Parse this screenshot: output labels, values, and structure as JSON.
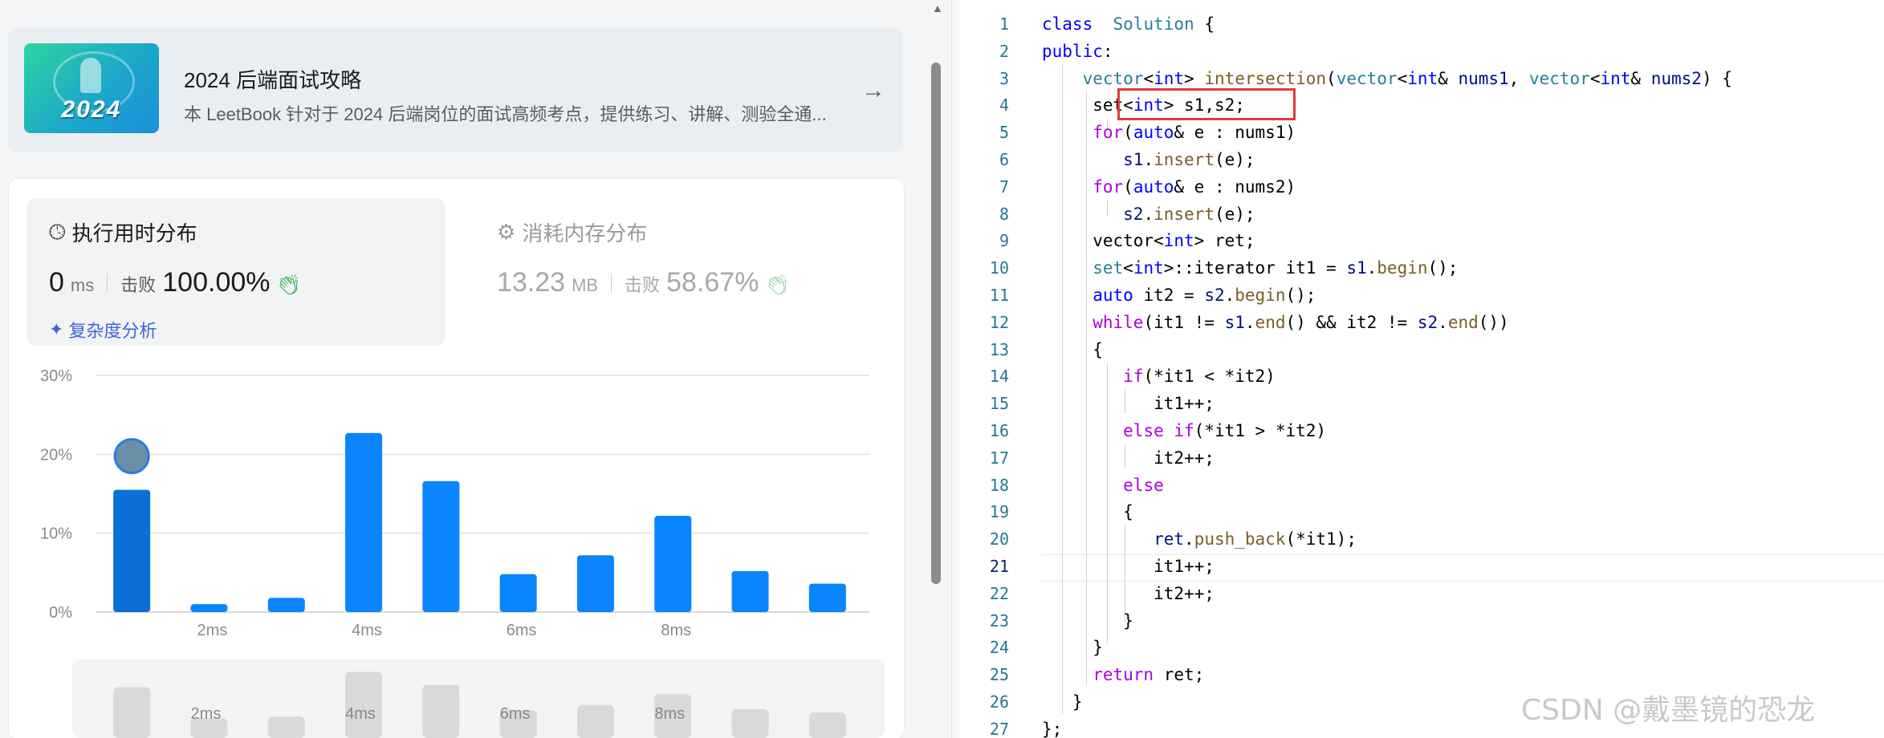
{
  "book": {
    "cover_year": "2024",
    "title": "2024 后端面试攻略",
    "description": "本 LeetBook 针对于 2024 后端岗位的面试高频考点，提供练习、讲解、测验全通..."
  },
  "runtime": {
    "tab_label": "执行用时分布",
    "value": "0",
    "unit": "ms",
    "beat_label": "击败",
    "beat_percent": "100.00%",
    "complexity_link": "复杂度分析"
  },
  "memory": {
    "tab_label": "消耗内存分布",
    "value": "13.23",
    "unit": "MB",
    "beat_label": "击败",
    "beat_percent": "58.67%"
  },
  "chart_data": {
    "type": "bar",
    "y_ticks": [
      "30%",
      "20%",
      "10%",
      "0%"
    ],
    "ylim": [
      0,
      30
    ],
    "grid": true,
    "x_tick_labels": [
      "2ms",
      "4ms",
      "6ms",
      "8ms"
    ],
    "values": [
      15.5,
      1.0,
      1.8,
      22.7,
      16.6,
      4.8,
      7.2,
      12.2,
      5.2,
      3.6
    ],
    "highlight_index": 0,
    "colors": {
      "bar": "#0a84ff",
      "highlight": "#0a6fd6",
      "grid": "#e6e6e6",
      "overview_bar": "#d9d9d9"
    },
    "overview_labels": [
      "2ms",
      "4ms",
      "6ms",
      "8ms"
    ]
  },
  "editor": {
    "active_line": 21,
    "lines": [
      {
        "n": 1,
        "tokens": [
          [
            "kw",
            "class"
          ],
          [
            "",
            "  "
          ],
          [
            "ty",
            "Solution"
          ],
          [
            "",
            " {"
          ]
        ]
      },
      {
        "n": 2,
        "tokens": [
          [
            "kw",
            "public"
          ],
          [
            "",
            ":"
          ]
        ]
      },
      {
        "n": 3,
        "tokens": [
          [
            "",
            "    "
          ],
          [
            "ty",
            "vector"
          ],
          [
            "",
            "<"
          ],
          [
            "kw",
            "int"
          ],
          [
            "",
            "> "
          ],
          [
            "fn",
            "intersection"
          ],
          [
            "",
            "("
          ],
          [
            "ty",
            "vector"
          ],
          [
            "",
            "<"
          ],
          [
            "kw",
            "int"
          ],
          [
            "",
            "& "
          ],
          [
            "vr",
            "nums1"
          ],
          [
            "",
            ", "
          ],
          [
            "ty",
            "vector"
          ],
          [
            "",
            "<"
          ],
          [
            "kw",
            "int"
          ],
          [
            "",
            "& "
          ],
          [
            "vr",
            "nums2"
          ],
          [
            "",
            ") {"
          ]
        ]
      },
      {
        "n": 4,
        "tokens": [
          [
            "",
            "     "
          ],
          [
            "",
            "set"
          ],
          [
            "",
            "<"
          ],
          [
            "kw",
            "int"
          ],
          [
            "",
            "> s1,s2;"
          ]
        ]
      },
      {
        "n": 5,
        "tokens": [
          [
            "",
            "     "
          ],
          [
            "kw2",
            "for"
          ],
          [
            "",
            "("
          ],
          [
            "kw",
            "auto"
          ],
          [
            "",
            "& e : nums1)"
          ]
        ]
      },
      {
        "n": 6,
        "tokens": [
          [
            "",
            "        "
          ],
          [
            "vr",
            "s1"
          ],
          [
            "",
            "."
          ],
          [
            "fn",
            "insert"
          ],
          [
            "",
            "(e);"
          ]
        ]
      },
      {
        "n": 7,
        "tokens": [
          [
            "",
            "     "
          ],
          [
            "kw2",
            "for"
          ],
          [
            "",
            "("
          ],
          [
            "kw",
            "auto"
          ],
          [
            "",
            "& e : nums2)"
          ]
        ]
      },
      {
        "n": 8,
        "tokens": [
          [
            "",
            "        "
          ],
          [
            "vr",
            "s2"
          ],
          [
            "",
            "."
          ],
          [
            "fn",
            "insert"
          ],
          [
            "",
            "(e);"
          ]
        ]
      },
      {
        "n": 9,
        "tokens": [
          [
            "",
            "     "
          ],
          [
            "",
            "vector<"
          ],
          [
            "kw",
            "int"
          ],
          [
            "",
            "> ret;"
          ]
        ]
      },
      {
        "n": 10,
        "tokens": [
          [
            "",
            "     "
          ],
          [
            "ty",
            "set"
          ],
          [
            "",
            "<"
          ],
          [
            "kw",
            "int"
          ],
          [
            "",
            ">::iterator it1 = "
          ],
          [
            "vr",
            "s1"
          ],
          [
            "",
            "."
          ],
          [
            "fn",
            "begin"
          ],
          [
            "",
            "();"
          ]
        ]
      },
      {
        "n": 11,
        "tokens": [
          [
            "",
            "     "
          ],
          [
            "kw",
            "auto"
          ],
          [
            "",
            " it2 = "
          ],
          [
            "vr",
            "s2"
          ],
          [
            "",
            "."
          ],
          [
            "fn",
            "begin"
          ],
          [
            "",
            "();"
          ]
        ]
      },
      {
        "n": 12,
        "tokens": [
          [
            "",
            "     "
          ],
          [
            "kw2",
            "while"
          ],
          [
            "",
            "(it1 != "
          ],
          [
            "vr",
            "s1"
          ],
          [
            "",
            "."
          ],
          [
            "fn",
            "end"
          ],
          [
            "",
            "() && it2 != "
          ],
          [
            "vr",
            "s2"
          ],
          [
            "",
            "."
          ],
          [
            "fn",
            "end"
          ],
          [
            "",
            "())"
          ]
        ]
      },
      {
        "n": 13,
        "tokens": [
          [
            "",
            "     {"
          ]
        ]
      },
      {
        "n": 14,
        "tokens": [
          [
            "",
            "        "
          ],
          [
            "kw2",
            "if"
          ],
          [
            "",
            "(*it1 < *it2)"
          ]
        ]
      },
      {
        "n": 15,
        "tokens": [
          [
            "",
            "           it1++;"
          ]
        ]
      },
      {
        "n": 16,
        "tokens": [
          [
            "",
            "        "
          ],
          [
            "kw2",
            "else if"
          ],
          [
            "",
            "(*it1 > *it2)"
          ]
        ]
      },
      {
        "n": 17,
        "tokens": [
          [
            "",
            "           it2++;"
          ]
        ]
      },
      {
        "n": 18,
        "tokens": [
          [
            "",
            "        "
          ],
          [
            "kw2",
            "else"
          ]
        ]
      },
      {
        "n": 19,
        "tokens": [
          [
            "",
            "        {"
          ]
        ]
      },
      {
        "n": 20,
        "tokens": [
          [
            "",
            "           "
          ],
          [
            "vr",
            "ret"
          ],
          [
            "",
            "."
          ],
          [
            "fn",
            "push_back"
          ],
          [
            "",
            "(*it1);"
          ]
        ]
      },
      {
        "n": 21,
        "tokens": [
          [
            "",
            "           it1++;"
          ]
        ]
      },
      {
        "n": 22,
        "tokens": [
          [
            "",
            "           it2++;"
          ]
        ]
      },
      {
        "n": 23,
        "tokens": [
          [
            "",
            "        }"
          ]
        ]
      },
      {
        "n": 24,
        "tokens": [
          [
            "",
            "     }"
          ]
        ]
      },
      {
        "n": 25,
        "tokens": [
          [
            "",
            "     "
          ],
          [
            "kw2",
            "return"
          ],
          [
            "",
            " ret;"
          ]
        ]
      },
      {
        "n": 26,
        "tokens": [
          [
            "",
            "   }"
          ]
        ]
      },
      {
        "n": 27,
        "tokens": [
          [
            "",
            "};"
          ]
        ]
      }
    ]
  },
  "watermark": "CSDN @戴墨镜的恐龙"
}
